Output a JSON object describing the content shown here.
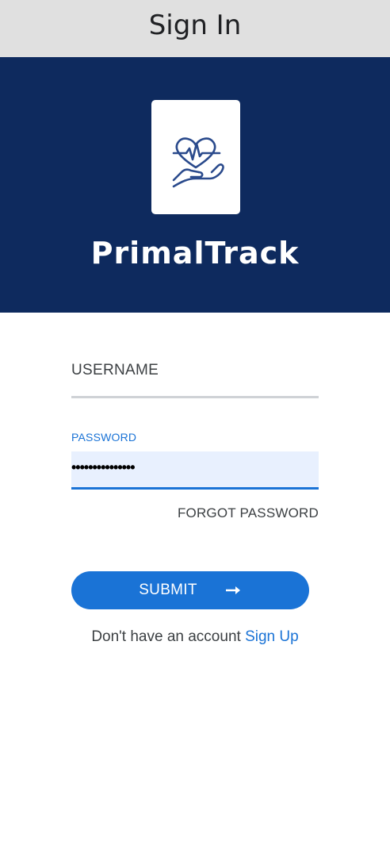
{
  "header": {
    "title": "Sign In"
  },
  "hero": {
    "logo_icon": "heart-in-hand-icon",
    "brand_name": "PrimalTrack",
    "background_color": "#0e2a5e"
  },
  "form": {
    "username": {
      "label": "USERNAME",
      "value": ""
    },
    "password": {
      "label": "PASSWORD",
      "value": "•••••••••••••••"
    },
    "forgot_password_label": "FORGOT PASSWORD",
    "submit_label": "SUBMIT",
    "submit_icon": "arrow-right-icon",
    "signup_prompt": "Don't have an account",
    "signup_link_label": "Sign Up"
  },
  "colors": {
    "accent": "#1a73d6",
    "header_bg": "#e0e0e0",
    "field_focus_bg": "#e8f0fe"
  }
}
